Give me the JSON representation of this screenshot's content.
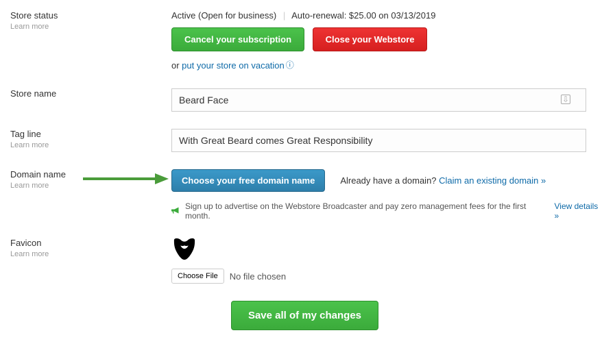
{
  "labels": {
    "store_status": "Store status",
    "store_name": "Store name",
    "tag_line": "Tag line",
    "domain_name": "Domain name",
    "favicon": "Favicon",
    "learn_more": "Learn more"
  },
  "store_status": {
    "active_text": "Active (Open for business)",
    "renewal_text": "Auto-renewal: $25.00 on 03/13/2019",
    "cancel_btn": "Cancel your subscription",
    "close_btn": "Close your Webstore",
    "or_text": "or ",
    "vacation_link": "put your store on vacation"
  },
  "store_name": {
    "value": "Beard Face"
  },
  "tag_line": {
    "value": "With Great Beard comes Great Responsibility"
  },
  "domain": {
    "choose_btn": "Choose your free domain name",
    "already_text": "Already have a domain? ",
    "claim_link": "Claim an existing domain »",
    "promo_text": "Sign up to advertise on the Webstore Broadcaster and pay zero management fees for the first month. ",
    "view_details": "View details »"
  },
  "favicon": {
    "choose_file": "Choose File",
    "no_file": "No file chosen"
  },
  "save_btn": "Save all of my changes"
}
